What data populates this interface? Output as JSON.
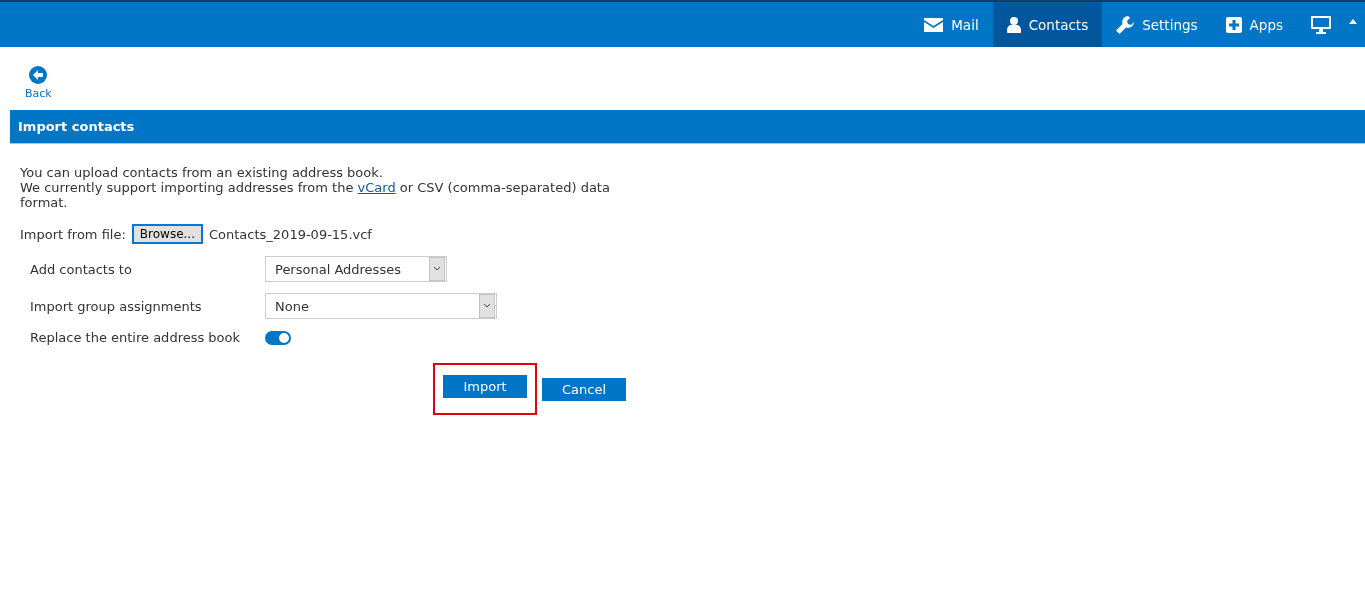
{
  "nav": [
    {
      "label": "Mail",
      "selected": false
    },
    {
      "label": "Contacts",
      "selected": true
    },
    {
      "label": "Settings",
      "selected": false
    },
    {
      "label": "Apps",
      "selected": false
    }
  ],
  "back": {
    "label": "Back"
  },
  "panel": {
    "title": "Import contacts"
  },
  "intro": {
    "line1": "You can upload contacts from an existing address book.",
    "before": "We currently support importing addresses from the",
    "link": "vCard",
    "after": "or CSV (comma-separated) data format."
  },
  "file": {
    "label": "Import from file:",
    "button": "Browse...",
    "value": "Contacts_2019-09-15.vcf"
  },
  "options": [
    {
      "kind": "select",
      "label": "Add contacts to",
      "value": "Personal Addresses"
    },
    {
      "kind": "select",
      "label": "Import group assignments",
      "value": "None"
    },
    {
      "kind": "toggle",
      "label": "Replace the entire address book",
      "on": true
    }
  ],
  "buttons": [
    {
      "label": "Import",
      "highlighted": true
    },
    {
      "label": "Cancel",
      "highlighted": false
    }
  ]
}
